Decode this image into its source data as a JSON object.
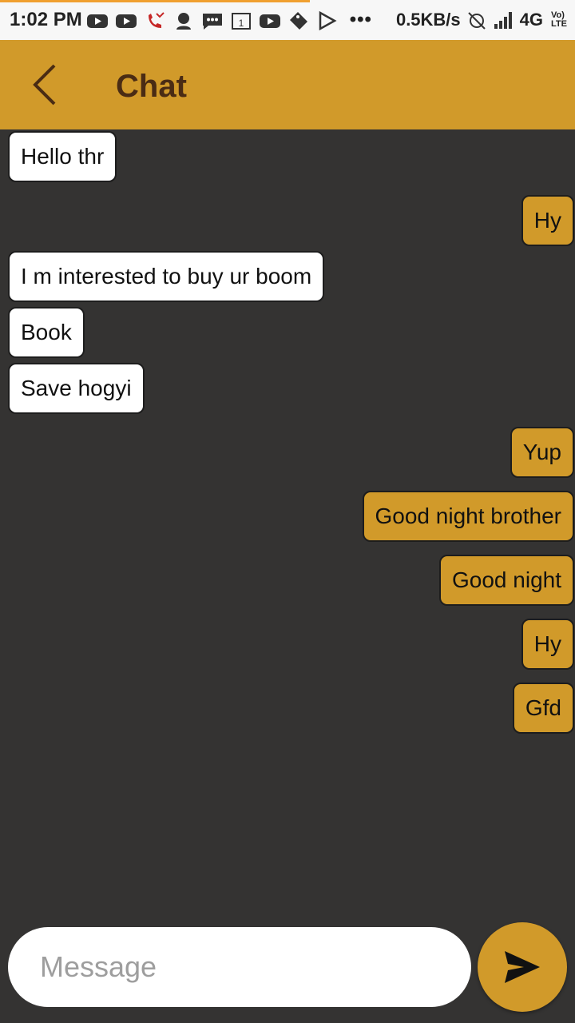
{
  "status_bar": {
    "time": "1:02 PM",
    "dots": "•••",
    "network_speed": "0.5KB/s",
    "network_type": "4G",
    "volte_line1": "Vo)",
    "volte_line2": "LTE",
    "icons": [
      "youtube-icon",
      "youtube-icon",
      "missed-call-icon",
      "person-icon",
      "message-icon",
      "calendar-icon",
      "youtube-icon",
      "tag-icon",
      "play-store-icon",
      "alarm-off-icon",
      "signal-icon",
      "4g-icon",
      "volte-icon"
    ]
  },
  "app_bar": {
    "title": "Chat",
    "back_icon": "back-arrow-icon"
  },
  "messages": [
    {
      "text": "Hello thr",
      "direction": "received"
    },
    {
      "text": "Hy",
      "direction": "sent"
    },
    {
      "text": "I m interested to buy ur boom",
      "direction": "received"
    },
    {
      "text": "Book",
      "direction": "received"
    },
    {
      "text": "Save hogyi",
      "direction": "received"
    },
    {
      "text": "Yup",
      "direction": "sent"
    },
    {
      "text": "Good night brother",
      "direction": "sent"
    },
    {
      "text": "Good night",
      "direction": "sent"
    },
    {
      "text": "Hy",
      "direction": "sent"
    },
    {
      "text": "Gfd",
      "direction": "sent"
    }
  ],
  "composer": {
    "placeholder": "Message",
    "value": "",
    "send_icon": "send-icon"
  },
  "colors": {
    "accent": "#d19a2a",
    "background": "#343332",
    "title_text": "#4a2c14",
    "received_bubble": "#ffffff"
  }
}
